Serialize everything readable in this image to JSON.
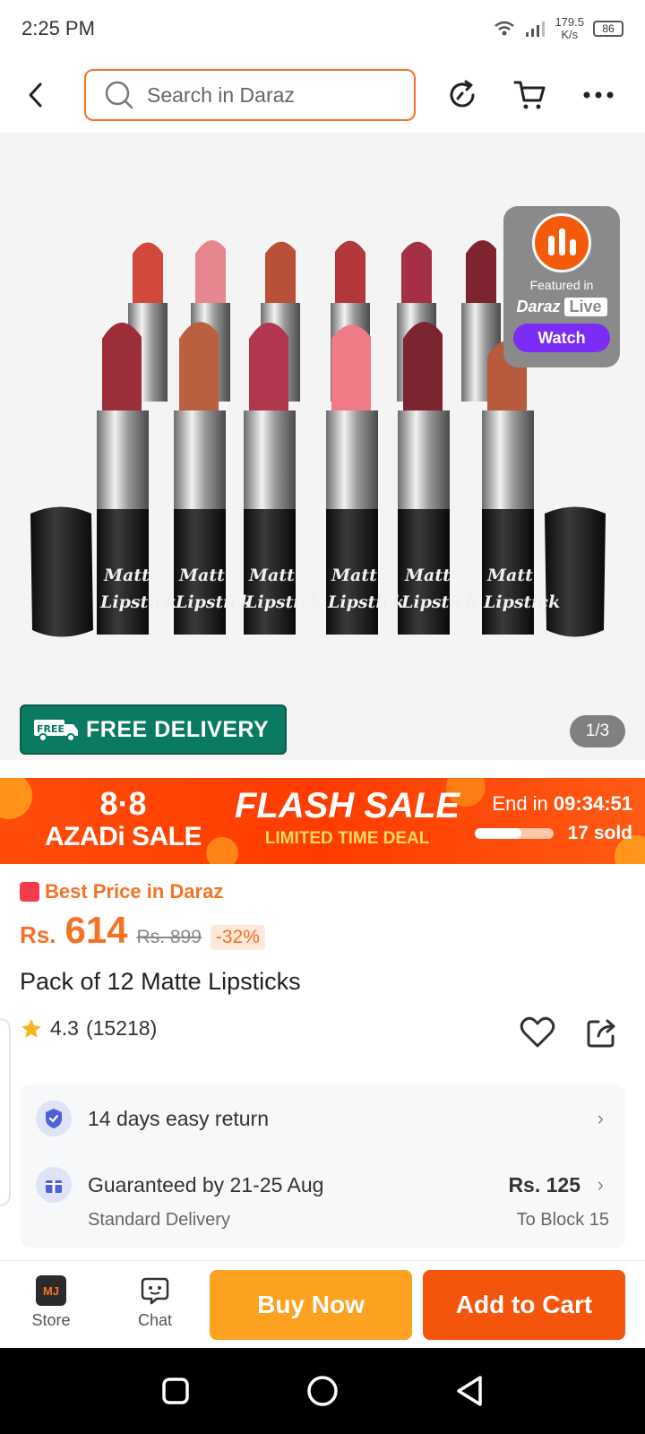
{
  "status_bar": {
    "time": "2:25 PM",
    "net_speed_value": "179.5",
    "net_speed_unit": "K/s",
    "battery": "86"
  },
  "top_nav": {
    "search_placeholder": "Search in Daraz"
  },
  "product_image": {
    "lipstick_labels": [
      "Matt",
      "Lipstick"
    ],
    "live": {
      "featured": "Featured in",
      "brand_daraz": "Daraz",
      "brand_live": "Live",
      "watch": "Watch"
    },
    "free_delivery": "FREE DELIVERY",
    "free_badge": "FREE",
    "counter": "1/3"
  },
  "flash_sale": {
    "azadi_top": "8·8",
    "azadi_bottom": "AZADi SALE",
    "title": "FLASH SALE",
    "subtitle": "LIMITED TIME DEAL",
    "end_label": "End in",
    "end_time": "09:34:51",
    "sold": "17 sold",
    "sold_progress": 0.6
  },
  "product": {
    "best_price": "Best Price in Daraz",
    "currency": "Rs.",
    "price": "614",
    "old_price": "Rs. 899",
    "discount": "-32%",
    "title": "Pack of 12 Matte Lipsticks",
    "rating": "4.3",
    "reviews": "(15218)"
  },
  "info": {
    "return": "14 days easy return",
    "delivery": "Guaranteed by 21-25 Aug",
    "delivery_type": "Standard Delivery",
    "delivery_fee": "Rs. 125",
    "delivery_to": "To Block 15"
  },
  "bottom_bar": {
    "store": "Store",
    "chat": "Chat",
    "store_logo": "MJ",
    "buy_now": "Buy Now",
    "add_to_cart": "Add to Cart"
  },
  "colors": {
    "accent": "#f57224",
    "buy_now": "#fca120",
    "add_to_cart": "#f5540c",
    "free_delivery": "#0a7a63",
    "live_watch": "#7b2cf5"
  }
}
